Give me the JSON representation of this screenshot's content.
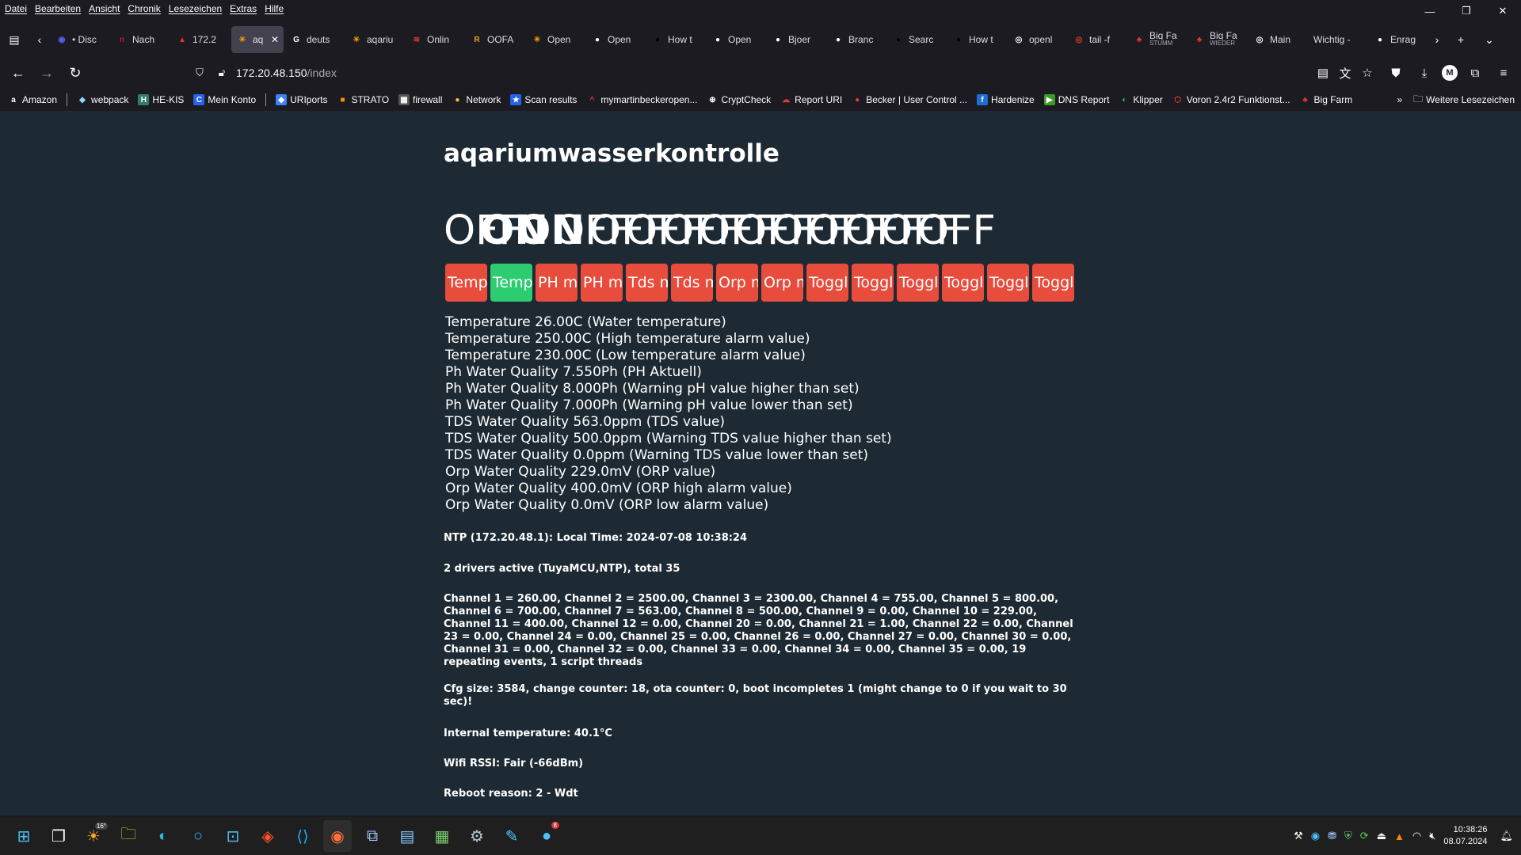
{
  "menu": [
    "Datei",
    "Bearbeiten",
    "Ansicht",
    "Chronik",
    "Lesezeichen",
    "Extras",
    "Hilfe"
  ],
  "window_controls": {
    "minimize": "—",
    "restore": "❐",
    "close": "✕"
  },
  "tabs": [
    {
      "title": "• Disc",
      "icon": "discord-icon",
      "glyph": "◉",
      "color": "#5865f2"
    },
    {
      "title": "Nach",
      "icon": "ntv-icon",
      "glyph": "n",
      "color": "#c8102e"
    },
    {
      "title": "172.2",
      "icon": "kong-icon",
      "glyph": "▲",
      "color": "#e5322d"
    },
    {
      "title": "aq",
      "icon": "tasmota-icon",
      "glyph": "✳",
      "color": "#f59e0b",
      "active": true
    },
    {
      "title": "deuts",
      "icon": "google-icon",
      "glyph": "G",
      "color": "#ffffff"
    },
    {
      "title": "aqariu",
      "icon": "tasmota-icon",
      "glyph": "✳",
      "color": "#f59e0b"
    },
    {
      "title": "Onlin",
      "icon": "wifi-icon",
      "glyph": "≋",
      "color": "#e53935"
    },
    {
      "title": "OOFA",
      "icon": "r-icon",
      "glyph": "R",
      "color": "#f59e0b"
    },
    {
      "title": "Open",
      "icon": "tasmota-icon",
      "glyph": "✳",
      "color": "#f59e0b"
    },
    {
      "title": "Open",
      "icon": "github-icon",
      "glyph": "●",
      "color": "#ffffff"
    },
    {
      "title": "How t",
      "icon": "openai-icon",
      "glyph": "●",
      "color": "#000000"
    },
    {
      "title": "Open",
      "icon": "github-icon",
      "glyph": "●",
      "color": "#ffffff"
    },
    {
      "title": "Bjoer",
      "icon": "github-icon",
      "glyph": "●",
      "color": "#ffffff"
    },
    {
      "title": "Branc",
      "icon": "github-icon",
      "glyph": "●",
      "color": "#ffffff"
    },
    {
      "title": "Searc",
      "icon": "openai-icon",
      "glyph": "●",
      "color": "#000000"
    },
    {
      "title": "How t",
      "icon": "openai-icon",
      "glyph": "●",
      "color": "#000000"
    },
    {
      "title": "openl",
      "icon": "target-icon",
      "glyph": "◎",
      "color": "#ffffff"
    },
    {
      "title": "tail -f",
      "icon": "target-icon",
      "glyph": "◎",
      "color": "#e53935"
    },
    {
      "title": "Big Fa",
      "subtitle": "STUMM",
      "icon": "bigfarm-icon",
      "glyph": "♣",
      "color": "#e53935"
    },
    {
      "title": "Big Fa",
      "subtitle": "WIEDER",
      "icon": "bigfarm-icon",
      "glyph": "♣",
      "color": "#e53935"
    },
    {
      "title": "Main",
      "icon": "target-icon",
      "glyph": "◎",
      "color": "#ffffff"
    },
    {
      "title": "Wichtig -",
      "icon": "",
      "glyph": "",
      "color": "#1c1b22"
    },
    {
      "title": "Enrag",
      "icon": "github-icon",
      "glyph": "●",
      "color": "#ffffff"
    }
  ],
  "url": {
    "host": "172.20.48.150",
    "path": "/index"
  },
  "bookmarks": [
    {
      "label": "Amazon",
      "icon": "amazon-icon",
      "glyph": "a",
      "color": "#ffffff",
      "bg": "#1c1b22"
    },
    {
      "label": "webpack",
      "icon": "webpack-icon",
      "glyph": "◆",
      "color": "#8ed6fb",
      "bg": "#1c1b22"
    },
    {
      "label": "HE-KIS",
      "icon": "hekis-icon",
      "glyph": "H",
      "color": "#ffffff",
      "bg": "#2f7d6b"
    },
    {
      "label": "Mein Konto",
      "icon": "konto-icon",
      "glyph": "C",
      "color": "#ffffff",
      "bg": "#2563eb"
    },
    {
      "label": "URIports",
      "icon": "uriports-icon",
      "glyph": "◆",
      "color": "#ffffff",
      "bg": "#3b82f6"
    },
    {
      "label": "STRATO",
      "icon": "strato-icon",
      "glyph": "■",
      "color": "#ff8c00",
      "bg": "#1c1b22"
    },
    {
      "label": "firewall",
      "icon": "firewall-icon",
      "glyph": "▦",
      "color": "#ffffff",
      "bg": "#555555"
    },
    {
      "label": "Network",
      "icon": "network-icon",
      "glyph": "●",
      "color": "#f5c542",
      "bg": "#1c1b22"
    },
    {
      "label": "Scan results",
      "icon": "scan-icon",
      "glyph": "★",
      "color": "#ffffff",
      "bg": "#2563eb"
    },
    {
      "label": "mymartinbeckeropen...",
      "icon": "caret-icon",
      "glyph": "^",
      "color": "#e53935",
      "bg": "#1c1b22"
    },
    {
      "label": "CryptCheck",
      "icon": "globe-icon",
      "glyph": "⊕",
      "color": "#ffffff",
      "bg": "#1c1b22"
    },
    {
      "label": "Report URI",
      "icon": "cloud-icon",
      "glyph": "☁",
      "color": "#e53935",
      "bg": "#1c1b22"
    },
    {
      "label": "Becker | User Control ...",
      "icon": "usercontrol-icon",
      "glyph": "●",
      "color": "#e53935",
      "bg": "#1c1b22"
    },
    {
      "label": "Hardenize",
      "icon": "hardenize-icon",
      "glyph": "f",
      "color": "#ffffff",
      "bg": "#1d6fd8"
    },
    {
      "label": "DNS Report",
      "icon": "dns-icon",
      "glyph": "▶",
      "color": "#ffffff",
      "bg": "#3a9d23"
    },
    {
      "label": "Klipper",
      "icon": "klipper-icon",
      "glyph": "◐",
      "color": "#22c55e",
      "bg": "#1c1b22"
    },
    {
      "label": "Voron 2.4r2 Funktionst...",
      "icon": "voron-icon",
      "glyph": "⬡",
      "color": "#e53935",
      "bg": "#1c1b22"
    },
    {
      "label": "Big Farm",
      "icon": "bigfarm-icon",
      "glyph": "♣",
      "color": "#e53935",
      "bg": "#1c1b22"
    }
  ],
  "bookmarks_more": "Weitere Lesezeichen",
  "page": {
    "title": "aqariumwasserkontrolle",
    "states": [
      {
        "text": "OFF",
        "bold": false
      },
      {
        "text": "ON",
        "bold": true
      },
      {
        "text": "ON",
        "bold": true
      },
      {
        "text": "OFF",
        "bold": false
      },
      {
        "text": "OFF",
        "bold": false
      },
      {
        "text": "OFF",
        "bold": false
      },
      {
        "text": "OFF",
        "bold": false
      },
      {
        "text": "OFF",
        "bold": false
      },
      {
        "text": "OFF",
        "bold": false
      },
      {
        "text": "OFF",
        "bold": false
      },
      {
        "text": "OFF",
        "bold": false
      },
      {
        "text": "OFF",
        "bold": false
      },
      {
        "text": "OFF",
        "bold": false
      },
      {
        "text": "OFF",
        "bold": false
      }
    ],
    "buttons": [
      {
        "label": "Temp",
        "on": false
      },
      {
        "label": "Temp",
        "on": true
      },
      {
        "label": "PH ma",
        "on": false
      },
      {
        "label": "PH mi",
        "on": false
      },
      {
        "label": "Tds m",
        "on": false
      },
      {
        "label": "Tds m",
        "on": false
      },
      {
        "label": "Orp m",
        "on": false
      },
      {
        "label": "Orp m",
        "on": false
      },
      {
        "label": "Toggle",
        "on": false
      },
      {
        "label": "Toggle",
        "on": false
      },
      {
        "label": "Toggle",
        "on": false
      },
      {
        "label": "Toggle",
        "on": false
      },
      {
        "label": "Toggle",
        "on": false
      },
      {
        "label": "Toggle",
        "on": false
      }
    ],
    "readings": [
      "Temperature 26.00C (Water temperature)",
      "Temperature 250.00C (High temperature alarm value)",
      "Temperature 230.00C (Low temperature alarm value)",
      "Ph Water Quality 7.550Ph (PH Aktuell)",
      "Ph Water Quality 8.000Ph (Warning pH value higher than set)",
      "Ph Water Quality 7.000Ph (Warning pH value lower than set)",
      "TDS Water Quality 563.0ppm (TDS value)",
      "TDS Water Quality 500.0ppm (Warning TDS value higher than set)",
      "TDS Water Quality 0.0ppm (Warning TDS value lower than set)",
      "Orp Water Quality 229.0mV (ORP value)",
      "Orp Water Quality 400.0mV (ORP high alarm value)",
      "Orp Water Quality 0.0mV (ORP low alarm value)"
    ],
    "info": [
      "NTP (172.20.48.1): Local Time: 2024-07-08 10:38:24",
      "2 drivers active (TuyaMCU,NTP), total 35",
      "Channel 1 = 260.00, Channel 2 = 2500.00, Channel 3 = 2300.00, Channel 4 = 755.00, Channel 5 = 800.00, Channel 6 = 700.00, Channel 7 = 563.00, Channel 8 = 500.00, Channel 9 = 0.00, Channel 10 = 229.00, Channel 11 = 400.00, Channel 12 = 0.00, Channel 20 = 0.00, Channel 21 = 1.00, Channel 22 = 0.00, Channel 23 = 0.00, Channel 24 = 0.00, Channel 25 = 0.00, Channel 26 = 0.00, Channel 27 = 0.00, Channel 30 = 0.00, Channel 31 = 0.00, Channel 32 = 0.00, Channel 33 = 0.00, Channel 34 = 0.00, Channel 35 = 0.00, 19 repeating events, 1 script threads",
      "Cfg size: 3584, change counter: 18, ota counter: 0, boot incompletes 1 (might change to 0 if you wait to 30 sec)!",
      "Internal temperature: 40.1°C",
      "Wifi RSSI: Fair (-66dBm)",
      "Reboot reason: 2 - Wdt"
    ]
  },
  "taskbar": {
    "weather_temp": "16°",
    "notification_count": "8",
    "time": "10:38:26",
    "date": "08.07.2024"
  }
}
